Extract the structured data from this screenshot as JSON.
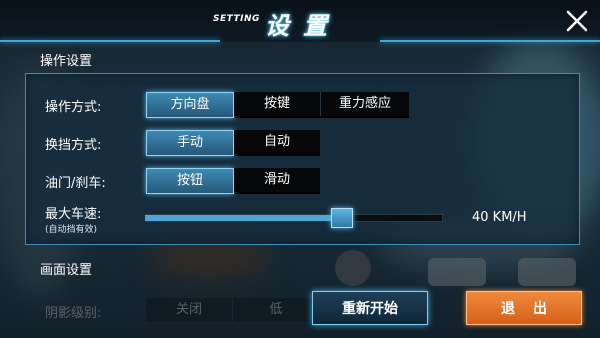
{
  "header": {
    "title_en": "SETTING",
    "title_cn": "设置"
  },
  "sections": {
    "controls_title": "操作设置",
    "display_title": "画面设置"
  },
  "controls": {
    "control_mode": {
      "label": "操作方式:",
      "options": [
        "方向盘",
        "按键",
        "重力感应"
      ],
      "selected": 0
    },
    "gear_mode": {
      "label": "换挡方式:",
      "options": [
        "手动",
        "自动"
      ],
      "selected": 0
    },
    "throttle_brake": {
      "label": "油门/刹车:",
      "options": [
        "按钮",
        "滑动"
      ],
      "selected": 0
    },
    "max_speed": {
      "label": "最大车速:",
      "note": "(自动挡有效)",
      "value_text": "40 KM/H",
      "level": 0.66
    }
  },
  "display": {
    "shadow_level": {
      "label": "阴影级别:",
      "options": [
        "关闭",
        "低"
      ]
    }
  },
  "buttons": {
    "restart": "重新开始",
    "exit": "退出"
  },
  "colors": {
    "accent": "#3fa9d8",
    "selected": "#3f89b2",
    "exit": "#f08a3a"
  }
}
